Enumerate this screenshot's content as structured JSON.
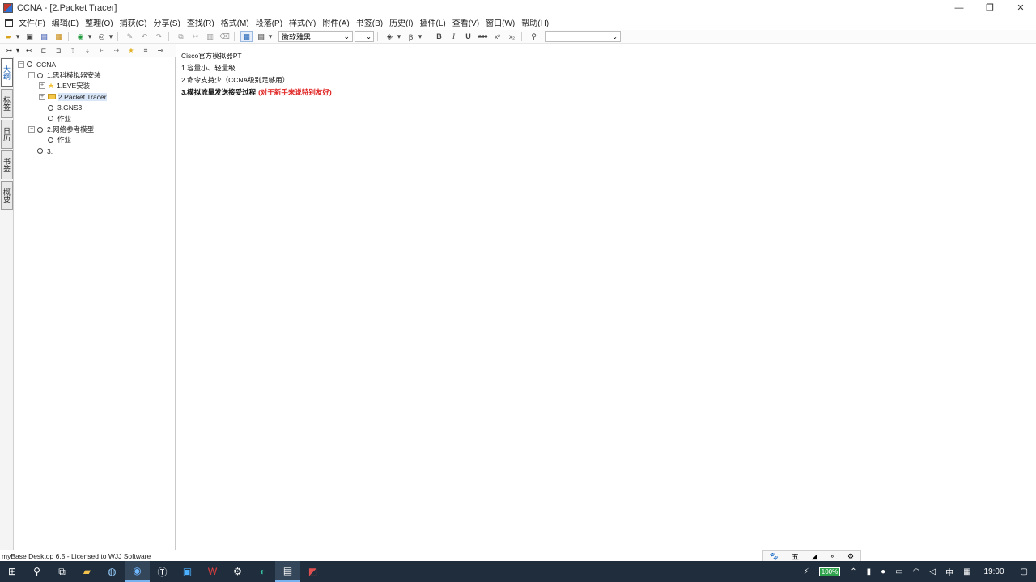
{
  "window": {
    "title": "CCNA - [2.Packet Tracer]",
    "controls": [
      "—",
      "❐",
      "✕"
    ]
  },
  "menu": [
    "文件(F)",
    "编辑(E)",
    "整理(O)",
    "捕获(C)",
    "分享(S)",
    "查找(R)",
    "格式(M)",
    "段落(P)",
    "样式(Y)",
    "附件(A)",
    "书签(B)",
    "历史(I)",
    "插件(L)",
    "查看(V)",
    "窗口(W)",
    "帮助(H)"
  ],
  "toolbar": {
    "font_name": "微软雅黑",
    "bold": "B",
    "italic": "I",
    "underline": "U",
    "strike": "abc",
    "superscript": "x²",
    "subscript": "x₂"
  },
  "side_tabs": [
    "大纲",
    "标签",
    "日历",
    "书签",
    "概要"
  ],
  "tree": {
    "root": "CCNA",
    "n1": "1.思科模拟器安装",
    "n1_1": "1.EVE安装",
    "n1_2": "2.Packet Tracer",
    "n1_3": "3.GNS3",
    "n1_4": "作业",
    "n2": "2.网络参考模型",
    "n2_1": "作业",
    "n3": "3."
  },
  "editor": {
    "line1": "Cisco官方模拟器PT",
    "line2": "1.容量小、轻量级",
    "line3": "2.命令支持少（CCNA级别足够用）",
    "line4": "3.模拟流量发送接受过程",
    "line4_note": "(对于新手来说特别友好)"
  },
  "status": {
    "text": "myBase Desktop 6.5 - Licensed to WJJ Software",
    "ime": [
      "🐾",
      "五",
      "◢",
      "∘",
      "⚙"
    ]
  },
  "taskbar": {
    "battery": "100%",
    "lang": "中",
    "time": "19:00"
  },
  "colors": {
    "accent": "#1a5fb4",
    "note_red": "#e02020",
    "taskbar": "#1f2d3d"
  }
}
